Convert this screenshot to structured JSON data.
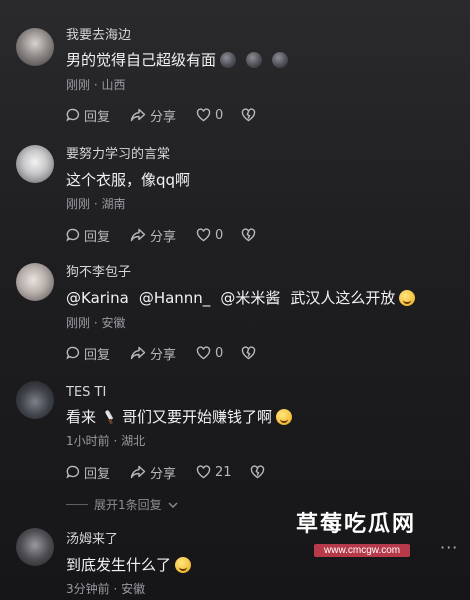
{
  "comments": [
    {
      "username": "我要去海边",
      "text": "男的觉得自己超级有面",
      "meta": "刚刚 · 山西",
      "reply_label": "回复",
      "share_label": "分享",
      "likes": "0"
    },
    {
      "username": "要努力学习的言棠",
      "text": "这个衣服，像qq啊",
      "meta": "刚刚 · 湖南",
      "reply_label": "回复",
      "share_label": "分享",
      "likes": "0"
    },
    {
      "username": "狗不李包子",
      "mentions": [
        "@Karina",
        "@Hannn_",
        "@米米酱"
      ],
      "text_after": "武汉人这么开放",
      "meta": "刚刚 · 安徽",
      "reply_label": "回复",
      "share_label": "分享",
      "likes": "0"
    },
    {
      "username": "TES TI",
      "text_before": "看来",
      "text_after": "哥们又要开始赚钱了啊",
      "meta": "1小时前 · 湖北",
      "reply_label": "回复",
      "share_label": "分享",
      "likes": "21"
    },
    {
      "username": "汤姆来了",
      "text": "到底发生什么了",
      "meta": "3分钟前 · 安徽"
    }
  ],
  "expand_replies": "展开1条回复",
  "watermark": {
    "title": "草莓吃瓜网",
    "url": "www.cmcgw.com"
  },
  "more_icon": "more-dots-icon"
}
